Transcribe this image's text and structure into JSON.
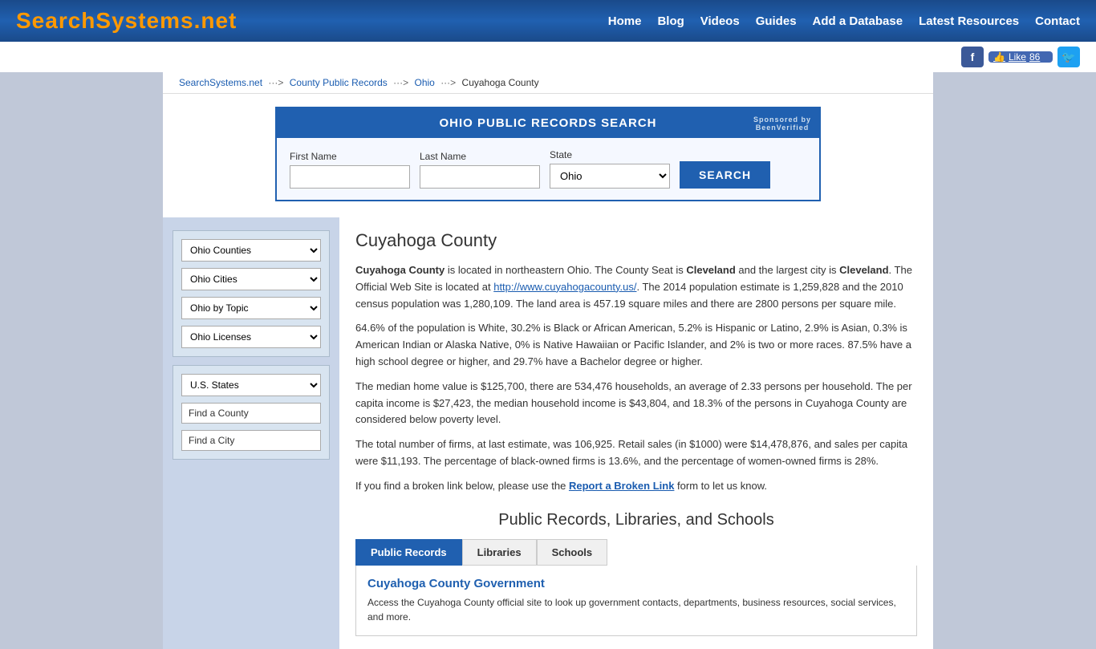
{
  "header": {
    "logo_text": "SearchSystems",
    "logo_suffix": ".net",
    "nav_items": [
      "Home",
      "Blog",
      "Videos",
      "Guides",
      "Add a Database",
      "Latest Resources",
      "Contact"
    ]
  },
  "social": {
    "like_count": "86"
  },
  "breadcrumb": {
    "items": [
      "SearchSystems.net",
      "County Public Records",
      "Ohio",
      "Cuyahoga County"
    ]
  },
  "search_box": {
    "title": "OHIO PUBLIC RECORDS SEARCH",
    "sponsored_by": "Sponsored by\nBeenVerified",
    "first_name_label": "First Name",
    "last_name_label": "Last Name",
    "state_label": "State",
    "state_value": "Ohio",
    "button_label": "SEARCH"
  },
  "sidebar": {
    "section1": {
      "dropdown1": "Ohio Counties",
      "dropdown2": "Ohio Cities",
      "dropdown3": "Ohio by Topic",
      "dropdown4": "Ohio Licenses"
    },
    "section2": {
      "dropdown1": "U.S. States",
      "link1": "Find a County",
      "link2": "Find a City"
    }
  },
  "county": {
    "title": "Cuyahoga County",
    "desc1": " is located in northeastern Ohio.  The County Seat is ",
    "county_seat": "Cleveland",
    "desc2": " and the largest city is ",
    "largest_city": "Cleveland",
    "desc3": ".  The Official Web Site is located at ",
    "website": "http://www.cuyahogacounty.us/",
    "desc4": ".  The 2014 population estimate is 1,259,828 and the 2010 census population was 1,280,109.  The land area is 457.19 square miles and there are 2800 persons per square mile.",
    "para2": "64.6% of the population is White, 30.2% is Black or African American, 5.2% is Hispanic or Latino, 2.9% is Asian, 0.3% is American Indian or Alaska Native, 0% is Native Hawaiian or Pacific Islander, and 2% is two or more races.  87.5% have a high school degree or higher, and 29.7% have a Bachelor degree or higher.",
    "para3": "The median home value is $125,700, there are 534,476 households, an average of 2.33 persons per household.  The per capita income is $27,423,  the median household income is $43,804, and 18.3% of the persons in Cuyahoga County are considered below poverty level.",
    "para4": "The total number of firms, at last estimate, was 106,925.  Retail sales (in $1000) were $14,478,876, and sales per capita were $11,193.  The percentage of black-owned firms is 13.6%, and the percentage of women-owned firms is 28%.",
    "broken_link_pre": "If you find a broken link below, please use the ",
    "broken_link_text": "Report a Broken Link",
    "broken_link_post": " form to let us know."
  },
  "records_section": {
    "title": "Public Records, Libraries, and Schools",
    "tabs": [
      "Public Records",
      "Libraries",
      "Schools"
    ],
    "active_tab": "Public Records",
    "record_title": "Cuyahoga County Government",
    "record_desc": "Access the Cuyahoga County official site to look up government contacts, departments, business resources, social services, and more."
  }
}
